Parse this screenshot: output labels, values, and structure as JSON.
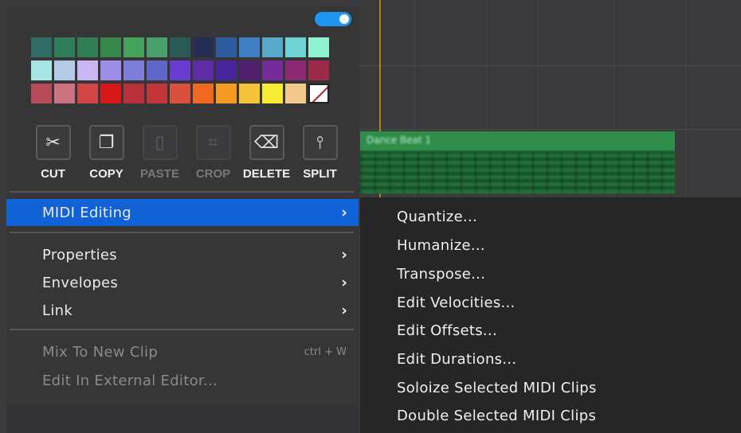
{
  "palette": {
    "rows": [
      [
        "#2e6b64",
        "#2e7d5b",
        "#2f7f52",
        "#36874a",
        "#45a25d",
        "#4aa06b",
        "#2a5a57",
        "#252e52",
        "#2d5c9e",
        "#3f7fc1",
        "#58a8c8",
        "#6ed2d2",
        "#8ff2d0"
      ],
      [
        "#a6e5e4",
        "#b3cbe6",
        "#cab6f4",
        "#9c8ee6",
        "#7d7ed8",
        "#5f66c8",
        "#6a3bd0",
        "#5f2ca8",
        "#48249a",
        "#4d1f6e",
        "#762b9a",
        "#8b2a72",
        "#9b2b48"
      ],
      [
        "#b84b57",
        "#cc7282",
        "#d24545",
        "#d61818",
        "#b8303a",
        "#c2363a",
        "#d9513c",
        "#ee6a22",
        "#f59b24",
        "#f5c23b",
        "#f5ec36",
        "#f3c98e",
        ""
      ]
    ],
    "no_color_icon": "no-color-icon"
  },
  "toolbar": {
    "tools": [
      {
        "label": "CUT",
        "icon": "scissors-icon",
        "glyph": "✂"
      },
      {
        "label": "COPY",
        "icon": "copy-icon",
        "glyph": "❐"
      },
      {
        "label": "PASTE",
        "icon": "paste-icon",
        "glyph": "▯"
      },
      {
        "label": "CROP",
        "icon": "crop-icon",
        "glyph": "⌗"
      },
      {
        "label": "DELETE",
        "icon": "delete-icon",
        "glyph": "⌫"
      },
      {
        "label": "SPLIT",
        "icon": "split-icon",
        "glyph": "⫯"
      }
    ]
  },
  "menu": {
    "midi_editing": "MIDI Editing",
    "properties": "Properties",
    "envelopes": "Envelopes",
    "link": "Link",
    "mix_to_new_clip": "Mix To New Clip",
    "mix_shortcut": "ctrl + W",
    "edit_external": "Edit In External Editor...",
    "chevron": "›"
  },
  "submenu": {
    "items": [
      "Quantize...",
      "Humanize...",
      "Transpose...",
      "Edit Velocities...",
      "Edit Offsets...",
      "Edit Durations...",
      "Soloize Selected MIDI Clips",
      "Double Selected MIDI Clips"
    ]
  },
  "background": {
    "clip_name": "Dance Beat 1"
  },
  "colors": {
    "accent": "#1162d6",
    "toggle": "#1e96ef"
  }
}
